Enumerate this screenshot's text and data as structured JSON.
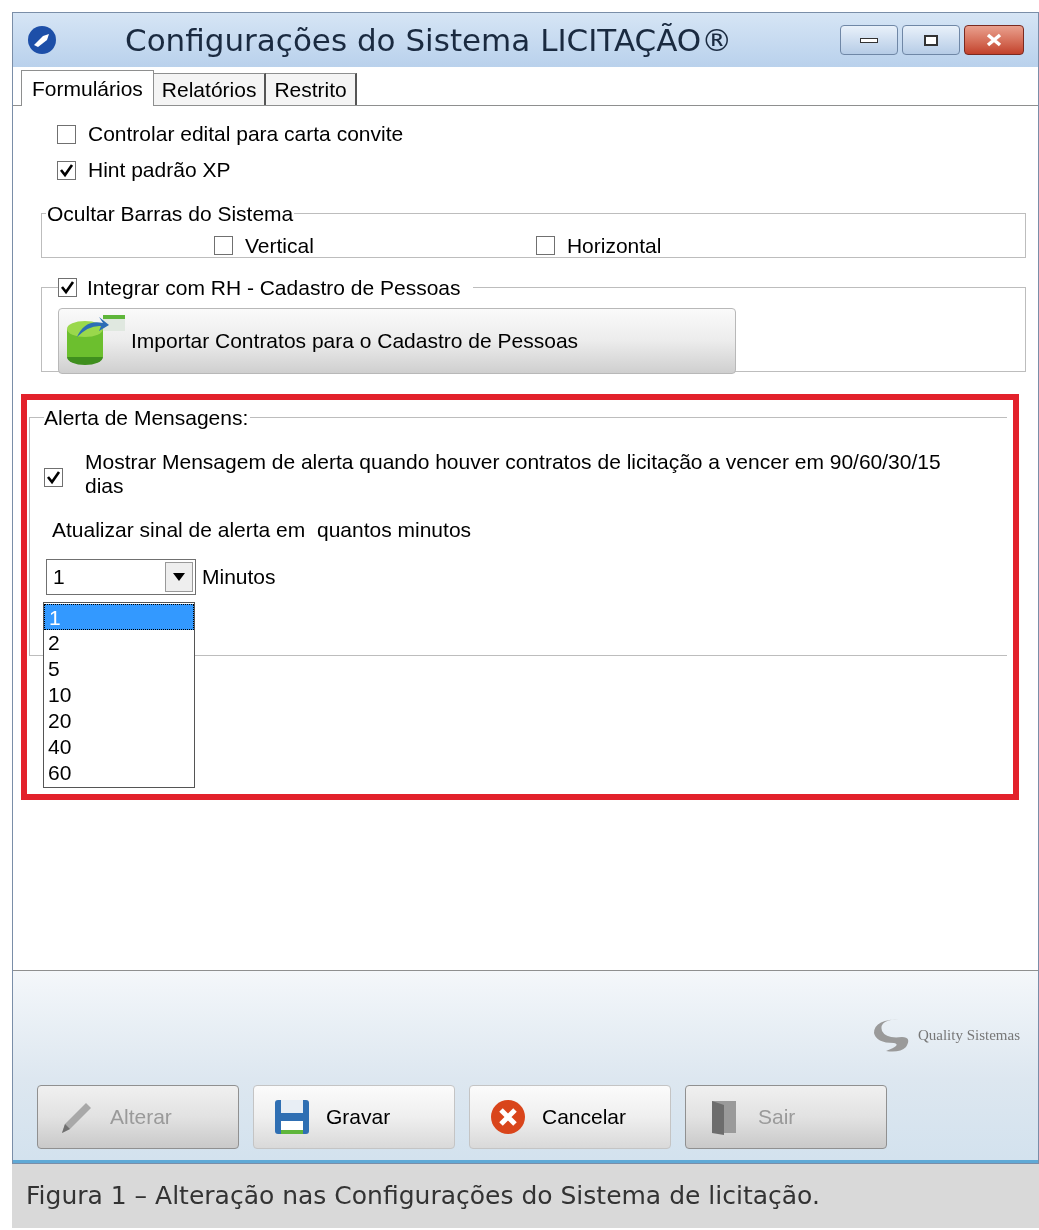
{
  "window": {
    "title": "Configurações do Sistema LICITAÇÃO®"
  },
  "tabs": [
    {
      "label": "Formulários",
      "selected": true
    },
    {
      "label": "Relatórios",
      "selected": false
    },
    {
      "label": "Restrito",
      "selected": false
    }
  ],
  "options": [
    {
      "label": "Controlar edital para carta convite",
      "checked": false
    },
    {
      "label": "Hint padrão XP",
      "checked": true
    }
  ],
  "hide_bars_group": {
    "title": "Ocultar Barras do Sistema",
    "options": [
      {
        "label": "Vertical",
        "checked": false
      },
      {
        "label": "Horizontal",
        "checked": false
      }
    ]
  },
  "hr_group": {
    "label": "Integrar com RH - Cadastro de Pessoas",
    "checked": true,
    "button": "Importar Contratos para o Cadastro de Pessoas"
  },
  "alert_group": {
    "title": "Alerta de Mensagens:",
    "show_alert": {
      "label": "Mostrar Mensagem de alerta quando houver contratos de licitação a vencer em 90/60/30/15 dias",
      "checked": true
    },
    "interval_label": "Atualizar sinal de alerta em  quantos minutos",
    "interval": {
      "value": "1",
      "unit": "Minutos",
      "options": [
        {
          "label": "1",
          "selected": true
        },
        {
          "label": "2",
          "selected": false
        },
        {
          "label": "5",
          "selected": false
        },
        {
          "label": "10",
          "selected": false
        },
        {
          "label": "20",
          "selected": false
        },
        {
          "label": "40",
          "selected": false
        },
        {
          "label": "60",
          "selected": false
        }
      ]
    }
  },
  "logo": "Quality Sistemas",
  "buttons": [
    {
      "label": "Alterar",
      "kind": "pencil",
      "disabled": true
    },
    {
      "label": "Gravar",
      "kind": "floppy",
      "disabled": false
    },
    {
      "label": "Cancelar",
      "kind": "cancel",
      "disabled": false
    },
    {
      "label": "Sair",
      "kind": "door",
      "disabled": true
    }
  ],
  "caption": "Figura 1 – Alteração nas Configurações do Sistema de licitação."
}
